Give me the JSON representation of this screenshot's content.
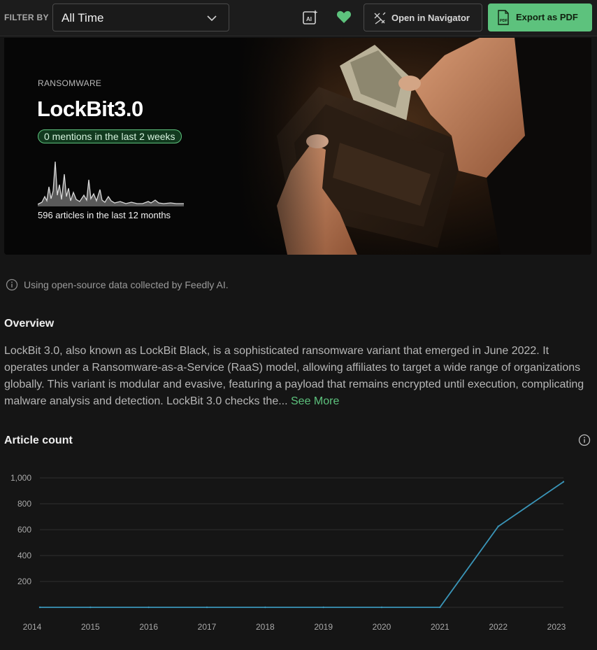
{
  "toolbar": {
    "filter_label": "FILTER BY",
    "filter_value": "All Time",
    "ai_icon": "ai-sparkle-icon",
    "heart_icon": "heart-icon",
    "navigator_label": "Open in Navigator",
    "pdf_label": "Export as PDF",
    "pdf_button_color": "#5dc27d"
  },
  "hero": {
    "category": "RANSOMWARE",
    "name": "LockBit3.0",
    "mentions": "0 mentions in the last 2 weeks",
    "articles_caption": "596 articles in the last 12 months",
    "accent_color": "#5dc27d"
  },
  "info_note": "Using open-source data collected by Feedly AI.",
  "overview": {
    "title": "Overview",
    "body": "LockBit 3.0, also known as LockBit Black, is a sophisticated ransomware variant that emerged in June 2022. It operates under a Ransomware-as-a-Service (RaaS) model, allowing affiliates to target a wide range of organizations globally. This variant is modular and evasive, featuring a payload that remains encrypted until execution, complicating malware analysis and detection. LockBit 3.0 checks the...",
    "see_more": "See More"
  },
  "article_count": {
    "title": "Article count"
  },
  "chart_data": {
    "type": "line",
    "categories": [
      "2014",
      "2015",
      "2016",
      "2017",
      "2018",
      "2019",
      "2020",
      "2021",
      "2022",
      "2023"
    ],
    "series": [
      {
        "values": [
          0,
          0,
          0,
          0,
          0,
          0,
          0,
          0,
          625,
          970
        ]
      }
    ],
    "y_ticks": [
      200,
      400,
      600,
      800,
      1000
    ],
    "y_tick_labels": [
      "200",
      "400",
      "600",
      "800",
      "1,000"
    ],
    "ylim": [
      0,
      1000
    ],
    "grid": true,
    "line_color": "#3a95b8"
  }
}
